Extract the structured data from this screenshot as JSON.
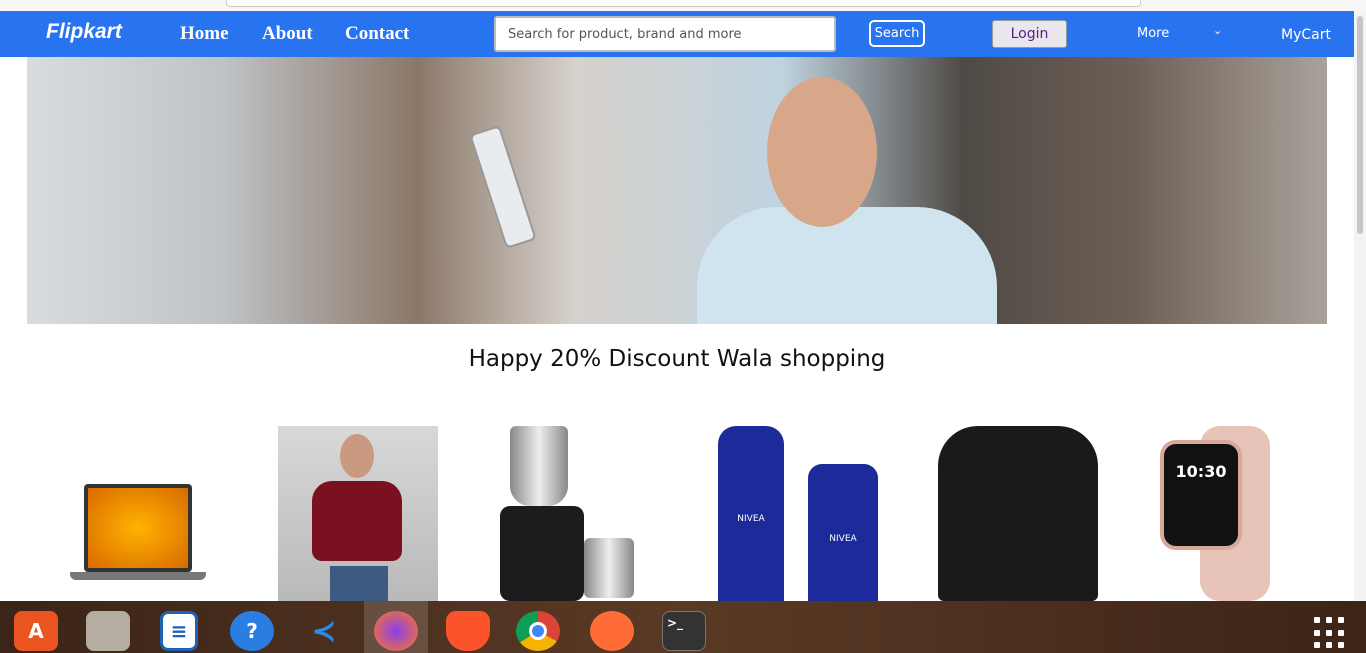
{
  "nav": {
    "logo": "Flipkart",
    "links": [
      "Home",
      "About",
      "Contact"
    ],
    "search_placeholder": "Search for product, brand and more",
    "search_button": "Search",
    "login": "Login",
    "more": "More",
    "more_chevron": "⌄",
    "cart": "MyCart"
  },
  "banner": {
    "heading": "Happy 20% Discount Wala shopping"
  },
  "products": [
    "laptop",
    "fashion-top",
    "mixer-grinder",
    "nivea-body-milk",
    "bluetooth-speaker",
    "smartwatch"
  ],
  "product_texts": {
    "nivea1": "NIVEA",
    "nivea2": "NIVEA",
    "watch_time": "10:30"
  },
  "taskbar": [
    "app-center-icon",
    "files-icon",
    "writer-icon",
    "help-icon",
    "vscode-icon",
    "firefox-icon",
    "brave-icon",
    "chrome-icon",
    "postman-icon",
    "terminal-icon"
  ]
}
